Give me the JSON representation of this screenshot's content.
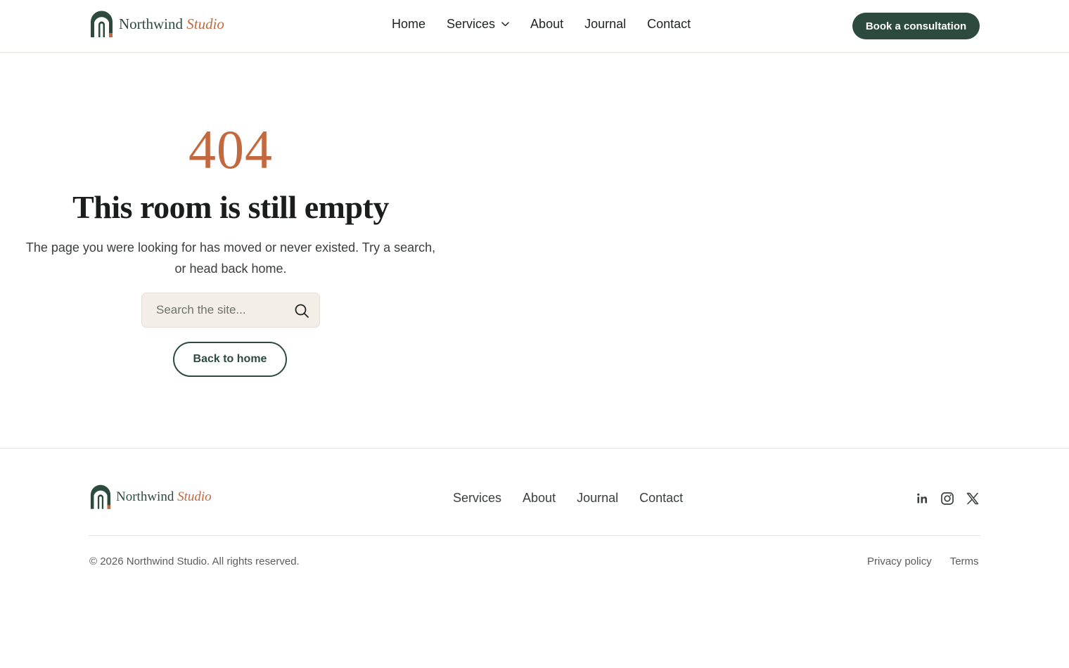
{
  "brand": {
    "name": "Northwind",
    "accent_word": "Studio"
  },
  "header": {
    "nav": [
      {
        "label": "Home"
      },
      {
        "label": "Services",
        "has_dropdown": true
      },
      {
        "label": "About"
      },
      {
        "label": "Journal"
      },
      {
        "label": "Contact"
      }
    ],
    "cta_label": "Book a consultation"
  },
  "error": {
    "code": "404",
    "title": "This room is still empty",
    "description": "The page you were looking for has moved or never existed. Try a search, or head back home.",
    "search": {
      "placeholder": "Search the site...",
      "value": ""
    },
    "back_label": "Back to home"
  },
  "footer": {
    "nav": [
      {
        "label": "Services"
      },
      {
        "label": "About"
      },
      {
        "label": "Journal"
      },
      {
        "label": "Contact"
      }
    ],
    "social": [
      "linkedin-icon",
      "instagram-icon",
      "x-icon"
    ],
    "copyright": "© 2026 Northwind Studio. All rights reserved.",
    "legal": [
      {
        "label": "Privacy policy"
      },
      {
        "label": "Terms"
      }
    ]
  },
  "colors": {
    "primary_green": "#2c4a3e",
    "accent_terracotta": "#c2693f",
    "search_background": "#f3eee7",
    "divider": "#e3e1dc"
  }
}
